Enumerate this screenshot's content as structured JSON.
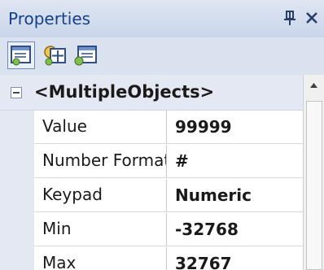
{
  "panel": {
    "title": "Properties",
    "pin_icon": "pin-icon",
    "close_icon": "close-icon"
  },
  "toolbar": {
    "buttons": [
      {
        "icon": "properties-view-icon",
        "pressed": true
      },
      {
        "icon": "add-property-icon",
        "pressed": false
      },
      {
        "icon": "property-pages-icon",
        "pressed": false
      }
    ]
  },
  "grid": {
    "category": {
      "label": "<MultipleObjects>",
      "expanded": true
    },
    "rows": [
      {
        "name": "Value",
        "value": "99999"
      },
      {
        "name": "Number Format",
        "value": "#"
      },
      {
        "name": "Keypad",
        "value": "Numeric"
      },
      {
        "name": "Min",
        "value": "-32768"
      },
      {
        "name": "Max",
        "value": "32767"
      }
    ]
  },
  "colors": {
    "title_text": "#15428b",
    "panel_bg": "#d6dbe9",
    "grid_gutter": "#e4e8f2"
  }
}
